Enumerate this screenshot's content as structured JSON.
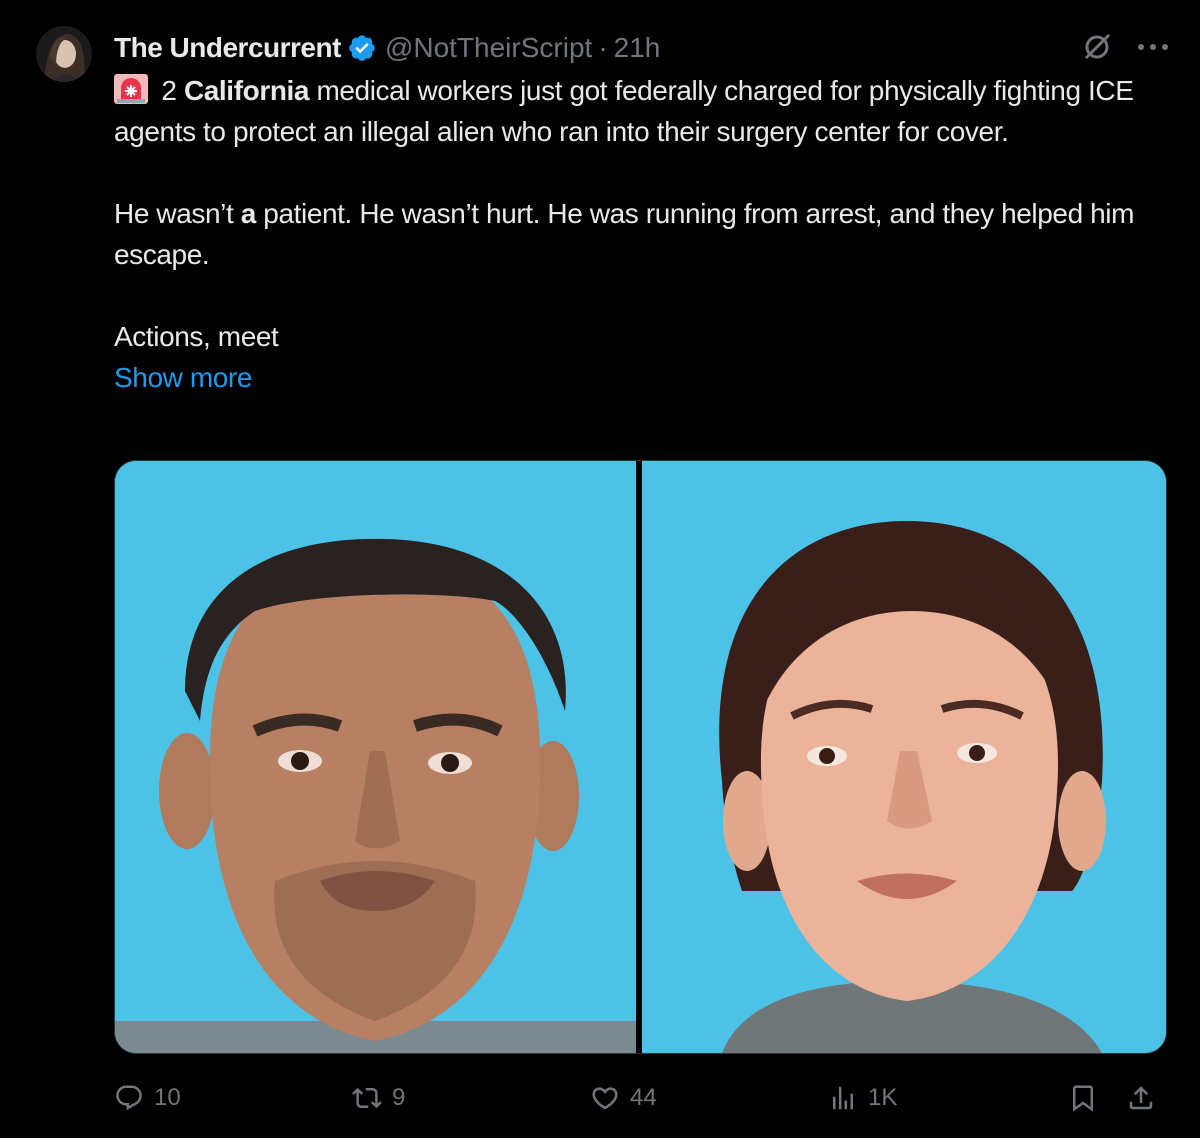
{
  "author": {
    "display_name": "The Undercurrent",
    "handle": "@NotTheirScript",
    "separator": "·",
    "time": "21h",
    "verified": true
  },
  "tweet": {
    "emoji_icon": "police-siren-icon",
    "line1_rest_pre": " 2 ",
    "line1_bold": "California",
    "line1_rest_post": " medical workers just got federally charged for physically fighting ICE agents to protect an illegal alien who ran into their surgery center for cover.",
    "para2_pre": "He wasn’t ",
    "para2_bold": "a",
    "para2_post": " patient. He wasn’t hurt. He was running from arrest, and they helped him escape.",
    "para3": "Actions, meet",
    "show_more": "Show more"
  },
  "media": {
    "images": [
      {
        "name": "mugshot-man"
      },
      {
        "name": "mugshot-woman"
      }
    ]
  },
  "actions": {
    "replies": "10",
    "reposts": "9",
    "likes": "44",
    "views": "1K"
  },
  "colors": {
    "background": "#000000",
    "text": "#e7e9ea",
    "muted": "#71767b",
    "link": "#1d9bf0",
    "verified": "#1d9bf0",
    "photo_bg": "#4cc3e6"
  }
}
